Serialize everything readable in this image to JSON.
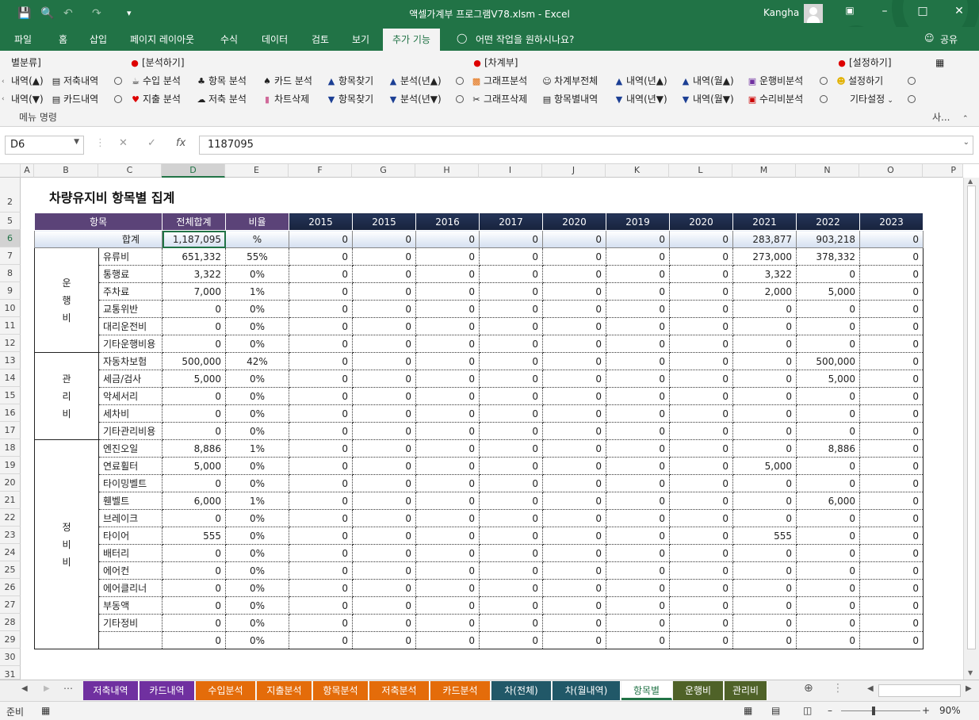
{
  "window": {
    "title": "액셀가계부 프로그램V78.xlsm  -  Excel",
    "user": "Kangha"
  },
  "ribbon_tabs": [
    "파일",
    "홈",
    "삽입",
    "페이지 레이아웃",
    "수식",
    "데이터",
    "검토",
    "보기",
    "추가 기능"
  ],
  "tell_me": "어떤 작업을 원하시나요?",
  "share": "공유",
  "ribbon": {
    "group_headers": [
      "별분류]",
      "[분석하기]",
      "[차계부]",
      "[설정하기]"
    ],
    "row1": [
      "내역(▲)",
      "저축내역",
      "수입 분석",
      "항목 분석",
      "카드 분석",
      "항목찾기",
      "분석(년▲)",
      "그래프분석",
      "차계부전체",
      "내역(년▲)",
      "내역(월▲)",
      "운행비분석",
      "설정하기"
    ],
    "row2": [
      "내역(▼)",
      "카드내역",
      "지출 분석",
      "저축 분석",
      "차트삭제",
      "항목찾기",
      "분석(년▼)",
      "그래프삭제",
      "항목별내역",
      "내역(년▼)",
      "내역(월▼)",
      "수리비분석",
      "기타설정"
    ],
    "menu_label": "메뉴 명령",
    "right_label": "사..."
  },
  "namebox": "D6",
  "formula": "1187095",
  "columns": [
    "A",
    "B",
    "C",
    "D",
    "E",
    "F",
    "G",
    "H",
    "I",
    "J",
    "K",
    "L",
    "M",
    "N",
    "O",
    "P"
  ],
  "rows": [
    "2",
    "5",
    "6",
    "7",
    "8",
    "9",
    "10",
    "11",
    "12",
    "13",
    "14",
    "15",
    "16",
    "17",
    "18",
    "19",
    "20",
    "21",
    "22",
    "23",
    "24",
    "25",
    "26",
    "27",
    "28",
    "29",
    "30",
    "31"
  ],
  "sheet": {
    "title": "차량유지비 항목별 집계",
    "header": {
      "item": "항목",
      "total": "전체합계",
      "ratio": "비율",
      "years": [
        "2015",
        "2015",
        "2016",
        "2017",
        "2020",
        "2019",
        "2020",
        "2021",
        "2022",
        "2023"
      ]
    },
    "total_row": {
      "label": "합계",
      "total": "1,187,095",
      "ratio": "%",
      "values": [
        "0",
        "0",
        "0",
        "0",
        "0",
        "0",
        "0",
        "283,877",
        "903,218",
        "0"
      ]
    },
    "groups": [
      "운\n행\n비",
      "관\n리\n비",
      "정\n비\n비"
    ],
    "items": [
      {
        "name": "유류비",
        "total": "651,332",
        "ratio": "55%",
        "values": [
          "0",
          "0",
          "0",
          "0",
          "0",
          "0",
          "0",
          "273,000",
          "378,332",
          "0"
        ]
      },
      {
        "name": "통행료",
        "total": "3,322",
        "ratio": "0%",
        "values": [
          "0",
          "0",
          "0",
          "0",
          "0",
          "0",
          "0",
          "3,322",
          "0",
          "0"
        ]
      },
      {
        "name": "주차료",
        "total": "7,000",
        "ratio": "1%",
        "values": [
          "0",
          "0",
          "0",
          "0",
          "0",
          "0",
          "0",
          "2,000",
          "5,000",
          "0"
        ]
      },
      {
        "name": "교통위반",
        "total": "0",
        "ratio": "0%",
        "values": [
          "0",
          "0",
          "0",
          "0",
          "0",
          "0",
          "0",
          "0",
          "0",
          "0"
        ]
      },
      {
        "name": "대리운전비",
        "total": "0",
        "ratio": "0%",
        "values": [
          "0",
          "0",
          "0",
          "0",
          "0",
          "0",
          "0",
          "0",
          "0",
          "0"
        ]
      },
      {
        "name": "기타운행비용",
        "total": "0",
        "ratio": "0%",
        "values": [
          "0",
          "0",
          "0",
          "0",
          "0",
          "0",
          "0",
          "0",
          "0",
          "0"
        ]
      },
      {
        "name": "자동차보험",
        "total": "500,000",
        "ratio": "42%",
        "values": [
          "0",
          "0",
          "0",
          "0",
          "0",
          "0",
          "0",
          "0",
          "500,000",
          "0"
        ]
      },
      {
        "name": "세금/검사",
        "total": "5,000",
        "ratio": "0%",
        "values": [
          "0",
          "0",
          "0",
          "0",
          "0",
          "0",
          "0",
          "0",
          "5,000",
          "0"
        ]
      },
      {
        "name": "악세서리",
        "total": "0",
        "ratio": "0%",
        "values": [
          "0",
          "0",
          "0",
          "0",
          "0",
          "0",
          "0",
          "0",
          "0",
          "0"
        ]
      },
      {
        "name": "세차비",
        "total": "0",
        "ratio": "0%",
        "values": [
          "0",
          "0",
          "0",
          "0",
          "0",
          "0",
          "0",
          "0",
          "0",
          "0"
        ]
      },
      {
        "name": "기타관리비용",
        "total": "0",
        "ratio": "0%",
        "values": [
          "0",
          "0",
          "0",
          "0",
          "0",
          "0",
          "0",
          "0",
          "0",
          "0"
        ]
      },
      {
        "name": "엔진오일",
        "total": "8,886",
        "ratio": "1%",
        "values": [
          "0",
          "0",
          "0",
          "0",
          "0",
          "0",
          "0",
          "0",
          "8,886",
          "0"
        ]
      },
      {
        "name": "연료휠터",
        "total": "5,000",
        "ratio": "0%",
        "values": [
          "0",
          "0",
          "0",
          "0",
          "0",
          "0",
          "0",
          "5,000",
          "0",
          "0"
        ]
      },
      {
        "name": "타이밍벨트",
        "total": "0",
        "ratio": "0%",
        "values": [
          "0",
          "0",
          "0",
          "0",
          "0",
          "0",
          "0",
          "0",
          "0",
          "0"
        ]
      },
      {
        "name": "휀벨트",
        "total": "6,000",
        "ratio": "1%",
        "values": [
          "0",
          "0",
          "0",
          "0",
          "0",
          "0",
          "0",
          "0",
          "6,000",
          "0"
        ]
      },
      {
        "name": "브레이크",
        "total": "0",
        "ratio": "0%",
        "values": [
          "0",
          "0",
          "0",
          "0",
          "0",
          "0",
          "0",
          "0",
          "0",
          "0"
        ]
      },
      {
        "name": "타이어",
        "total": "555",
        "ratio": "0%",
        "values": [
          "0",
          "0",
          "0",
          "0",
          "0",
          "0",
          "0",
          "555",
          "0",
          "0"
        ]
      },
      {
        "name": "배터리",
        "total": "0",
        "ratio": "0%",
        "values": [
          "0",
          "0",
          "0",
          "0",
          "0",
          "0",
          "0",
          "0",
          "0",
          "0"
        ]
      },
      {
        "name": "에어컨",
        "total": "0",
        "ratio": "0%",
        "values": [
          "0",
          "0",
          "0",
          "0",
          "0",
          "0",
          "0",
          "0",
          "0",
          "0"
        ]
      },
      {
        "name": "에어클리너",
        "total": "0",
        "ratio": "0%",
        "values": [
          "0",
          "0",
          "0",
          "0",
          "0",
          "0",
          "0",
          "0",
          "0",
          "0"
        ]
      },
      {
        "name": "부동액",
        "total": "0",
        "ratio": "0%",
        "values": [
          "0",
          "0",
          "0",
          "0",
          "0",
          "0",
          "0",
          "0",
          "0",
          "0"
        ]
      },
      {
        "name": "기타정비",
        "total": "0",
        "ratio": "0%",
        "values": [
          "0",
          "0",
          "0",
          "0",
          "0",
          "0",
          "0",
          "0",
          "0",
          "0"
        ]
      },
      {
        "name": "",
        "total": "0",
        "ratio": "0%",
        "values": [
          "0",
          "0",
          "0",
          "0",
          "0",
          "0",
          "0",
          "0",
          "0",
          "0"
        ]
      }
    ]
  },
  "sheet_tabs": [
    {
      "label": "저축내역",
      "color": "#7030a0"
    },
    {
      "label": "카드내역",
      "color": "#7030a0"
    },
    {
      "label": "수입분석",
      "color": "#e46c0a"
    },
    {
      "label": "지출분석",
      "color": "#e46c0a"
    },
    {
      "label": "항목분석",
      "color": "#e46c0a"
    },
    {
      "label": "저축분석",
      "color": "#e46c0a"
    },
    {
      "label": "카드분석",
      "color": "#e46c0a"
    },
    {
      "label": "차(전체)",
      "color": "#215868"
    },
    {
      "label": "차(월내역)",
      "color": "#215868"
    },
    {
      "label": "항목별",
      "color": "#ffffff"
    },
    {
      "label": "운행비",
      "color": "#4f6228"
    },
    {
      "label": "관리비",
      "color": "#4f6228"
    }
  ],
  "status": {
    "ready": "준비",
    "zoom": "90%"
  },
  "colors": {
    "excel_green": "#217346",
    "header_purple": "#5b4378",
    "header_navy": "#1e2b4a"
  }
}
